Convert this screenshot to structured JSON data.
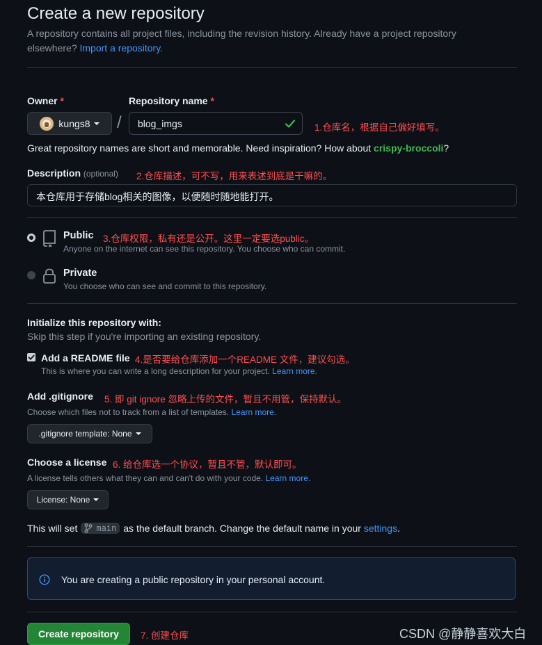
{
  "header": {
    "title": "Create a new repository",
    "subtitle": "A repository contains all project files, including the revision history. Already have a project repository elsewhere?",
    "import_link": "Import a repository."
  },
  "owner": {
    "label": "Owner",
    "required_mark": "*",
    "value": "kungs8"
  },
  "repo_name": {
    "label": "Repository name",
    "required_mark": "*",
    "value": "blog_imgs",
    "separator": "/",
    "annotation": "1.仓库名，根据自己偏好填写。"
  },
  "name_hint": {
    "text": "Great repository names are short and memorable. Need inspiration? How about",
    "suggestion": "crispy-broccoli",
    "end": "?"
  },
  "description": {
    "label": "Description",
    "optional": "(optional)",
    "annotation": "2.仓库描述，可不写，用来表述到底是干嘛的。",
    "value": "本仓库用于存储blog相关的图像，以便随时随地能打开。"
  },
  "visibility": {
    "annotation": "3.仓库权限，私有还是公开。这里一定要选public。",
    "public": {
      "label": "Public",
      "desc": "Anyone on the internet can see this repository. You choose who can commit.",
      "selected": true
    },
    "private": {
      "label": "Private",
      "desc": "You choose who can see and commit to this repository.",
      "selected": false
    }
  },
  "init": {
    "title": "Initialize this repository with:",
    "subtitle": "Skip this step if you're importing an existing repository.",
    "readme": {
      "label": "Add a README file",
      "checked": true,
      "annotation": "4.是否要给仓库添加一个README 文件，建议勾选。",
      "desc": "This is where you can write a long description for your project.",
      "learn": "Learn more."
    }
  },
  "gitignore": {
    "label": "Add .gitignore",
    "annotation": "5. 即 git ignore 忽略上传的文件，暂且不用管，保持默认。",
    "desc": "Choose which files not to track from a list of templates.",
    "learn": "Learn more.",
    "button": ".gitignore template: None"
  },
  "license": {
    "label": "Choose a license",
    "annotation": "6. 给仓库选一个协议，暂且不管，默认即可。",
    "desc": "A license tells others what they can and can't do with your code.",
    "learn": "Learn more.",
    "button": "License: None"
  },
  "branch": {
    "prefix": "This will set",
    "name": "main",
    "suffix": "as the default branch. Change the default name in your",
    "settings": "settings",
    "end": "."
  },
  "info_box": {
    "text": "You are creating a public repository in your personal account."
  },
  "submit": {
    "label": "Create repository",
    "annotation": "7. 创建仓库"
  },
  "watermark": "CSDN @静静喜欢大白",
  "colors": {
    "background": "#0d1117",
    "accent_green": "#238636",
    "link_blue": "#4493f8",
    "annotation_red": "#ff4d4f"
  }
}
